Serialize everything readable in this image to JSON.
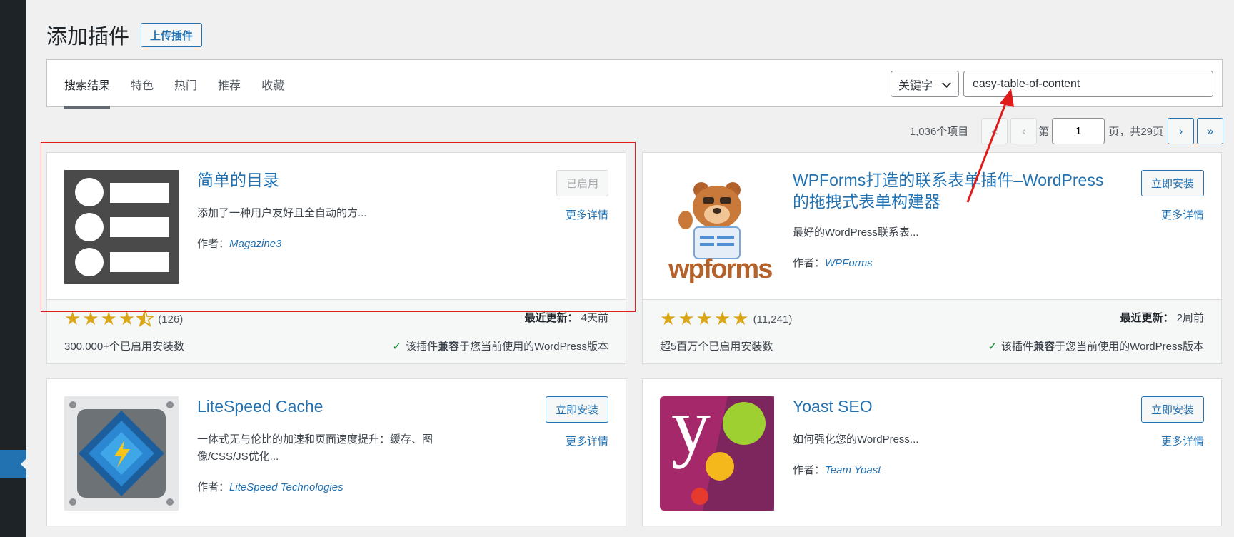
{
  "page": {
    "title": "添加插件",
    "upload_label": "上传插件"
  },
  "tabs": [
    {
      "label": "搜索结果",
      "active": true
    },
    {
      "label": "特色"
    },
    {
      "label": "热门"
    },
    {
      "label": "推荐"
    },
    {
      "label": "收藏"
    }
  ],
  "search": {
    "type_label": "关键字",
    "value": "easy-table-of-content"
  },
  "pagination": {
    "count_label": "1,036个项目",
    "first": "«",
    "prev": "‹",
    "page_prefix": "第",
    "current_page": "1",
    "page_suffix": "页，共29页",
    "next": "›",
    "last": "»"
  },
  "labels": {
    "more_details": "更多详情",
    "author_prefix": "作者：",
    "last_updated": "最近更新：",
    "compat_pre": "该插件",
    "compat_bold": "兼容",
    "compat_post": "于您当前使用的WordPress版本"
  },
  "plugins": [
    {
      "name": "简单的目录",
      "description": "添加了一种用户友好且全自动的方...",
      "author": "Magazine3",
      "action": "已启用",
      "rating_count": "(126)",
      "rating": 4.5,
      "installs": "300,000+个已启用安装数",
      "updated": "4天前",
      "icon": "list-icon"
    },
    {
      "name": "WPForms打造的联系表单插件–WordPress的拖拽式表单构建器",
      "description": "最好的WordPress联系表...",
      "author": "WPForms",
      "action": "立即安装",
      "rating_count": "(11,241)",
      "rating": 5,
      "installs": "超5百万个已启用安装数",
      "updated": "2周前",
      "icon": "wpforms-bear-icon",
      "icon_text": "wpforms"
    },
    {
      "name": "LiteSpeed Cache",
      "description": "一体式无与伦比的加速和页面速度提升：缓存、图像/CSS/JS优化...",
      "author": "LiteSpeed Technologies",
      "action": "立即安装",
      "icon": "litespeed-icon"
    },
    {
      "name": "Yoast SEO",
      "description": "如何强化您的WordPress...",
      "author": "Team Yoast",
      "action": "立即安装",
      "icon": "yoast-icon",
      "icon_text": "y"
    }
  ],
  "colors": {
    "accent": "#2271b1",
    "star": "#dba617",
    "highlight": "#e01b1b"
  }
}
